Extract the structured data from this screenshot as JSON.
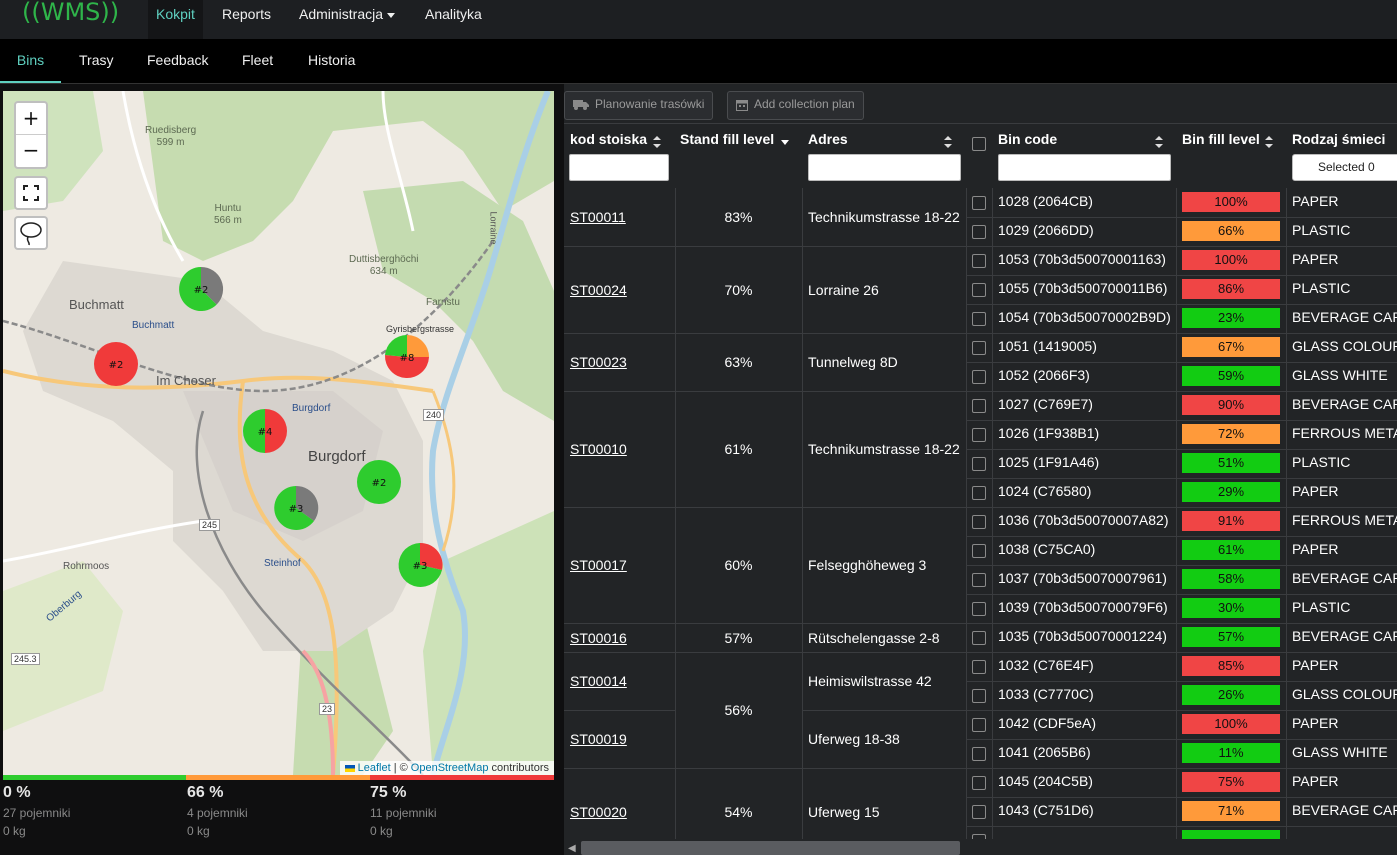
{
  "nav": {
    "logo": "((WMS))",
    "items": [
      {
        "label": "Kokpit",
        "active": true
      },
      {
        "label": "Reports",
        "active": false
      },
      {
        "label": "Administracja",
        "active": false,
        "dropdown": true
      },
      {
        "label": "Analityka",
        "active": false
      }
    ]
  },
  "tabs": [
    {
      "label": "Bins",
      "active": true
    },
    {
      "label": "Trasy",
      "active": false
    },
    {
      "label": "Feedback",
      "active": false
    },
    {
      "label": "Fleet",
      "active": false
    },
    {
      "label": "Historia",
      "active": false
    }
  ],
  "map": {
    "zoom_in": "+",
    "zoom_out": "−",
    "places": {
      "buchmatt": "Buchmatt",
      "buchmatt2": "Buchmatt",
      "im_choser": "Im Choser",
      "burgdorf": "Burgdorf",
      "burgdorf2": "Burgdorf",
      "steinhof": "Steinhof",
      "farnstu": "Farnstu",
      "duttisberg": "Duttisberghöchi",
      "duttisberg_h": "634 m",
      "huntu": "Huntu",
      "huntu_h": "566 m",
      "ruedisberg": "Ruedisberg",
      "ruedisberg_h": "599 m",
      "rohrmoos": "Rohrmoos",
      "oberburg": "Oberburg",
      "gyrisberg": "Gyrisbergstrasse",
      "lorraine": "Lorraine",
      "r240": "240",
      "r245": "245",
      "r2453": "245.3",
      "r23": "23"
    },
    "clusters": [
      {
        "label": "#2",
        "slices": [
          "#2ecc2e",
          "#7a7a7a"
        ]
      },
      {
        "label": "#2",
        "slices": [
          "#f03a3a"
        ]
      },
      {
        "label": "#8",
        "slices": [
          "#f03a3a",
          "#2ecc2e",
          "#ff9a3a"
        ]
      },
      {
        "label": "#4",
        "slices": [
          "#f03a3a",
          "#2ecc2e"
        ]
      },
      {
        "label": "#2",
        "slices": [
          "#2ecc2e"
        ]
      },
      {
        "label": "#3",
        "slices": [
          "#2ecc2e",
          "#7a7a7a"
        ]
      },
      {
        "label": "#3",
        "slices": [
          "#f03a3a",
          "#2ecc2e"
        ]
      }
    ],
    "attribution_prefix": "| ©",
    "attribution_leaflet": "Leaflet",
    "attribution_osm": "OpenStreetMap",
    "attribution_suffix": "contributors"
  },
  "stats": [
    {
      "pct": "0 %",
      "count": "27 pojemniki",
      "weight": "0 kg",
      "color": "#2ecc2e"
    },
    {
      "pct": "66 %",
      "count": "4 pojemniki",
      "weight": "0 kg",
      "color": "#ff9a3a"
    },
    {
      "pct": "75 %",
      "count": "11 pojemniki",
      "weight": "0 kg",
      "color": "#f03a3a"
    }
  ],
  "toolbar": {
    "plan_routes": "Planowanie trasówki",
    "add_plan": "Add collection plan"
  },
  "table": {
    "headers": {
      "code": "kod stoiska",
      "stand_fill": "Stand fill level",
      "address": "Adres",
      "bin_code": "Bin code",
      "bin_fill": "Bin fill level",
      "type": "Rodzaj śmieci"
    },
    "type_filter": "Selected 0",
    "stands": [
      {
        "code": "ST00011",
        "fill": "83%",
        "address": "Technikumstrasse 18-22"
      },
      {
        "code": "ST00024",
        "fill": "70%",
        "address": "Lorraine 26"
      },
      {
        "code": "ST00023",
        "fill": "63%",
        "address": "Tunnelweg 8D"
      },
      {
        "code": "ST00010",
        "fill": "61%",
        "address": "Technikumstrasse 18-22"
      },
      {
        "code": "ST00017",
        "fill": "60%",
        "address": "Felsegghöheweg 3"
      },
      {
        "code": "ST00016",
        "fill": "57%",
        "address": "Rütschelengasse 2-8"
      },
      {
        "code": "ST00014",
        "fill": "56%",
        "address": "Heimiswilstrasse 42"
      },
      {
        "code": "ST00019",
        "fill": "",
        "address": "Uferweg 18-38"
      },
      {
        "code": "ST00020",
        "fill": "54%",
        "address": "Uferweg 15"
      }
    ],
    "bins": [
      {
        "code": "1028 (2064CB)",
        "fill": "100%",
        "fill_value": 100,
        "color": "#f04545",
        "type": "PAPER"
      },
      {
        "code": "1029 (2066DD)",
        "fill": "66%",
        "fill_value": 66,
        "color": "#ff9a3a",
        "type": "PLASTIC"
      },
      {
        "code": "1053 (70b3d50070001163)",
        "fill": "100%",
        "fill_value": 100,
        "color": "#f04545",
        "type": "PAPER"
      },
      {
        "code": "1055 (70b3d500700011B6)",
        "fill": "86%",
        "fill_value": 86,
        "color": "#f04545",
        "type": "PLASTIC"
      },
      {
        "code": "1054 (70b3d50070002B9D)",
        "fill": "23%",
        "fill_value": 23,
        "color": "#12cc12",
        "type": "BEVERAGE CART"
      },
      {
        "code": "1051 (1419005)",
        "fill": "67%",
        "fill_value": 67,
        "color": "#ff9a3a",
        "type": "GLASS COLOURE"
      },
      {
        "code": "1052 (2066F3)",
        "fill": "59%",
        "fill_value": 59,
        "color": "#12cc12",
        "type": "GLASS WHITE"
      },
      {
        "code": "1027 (C769E7)",
        "fill": "90%",
        "fill_value": 90,
        "color": "#f04545",
        "type": "BEVERAGE CART"
      },
      {
        "code": "1026 (1F938B1)",
        "fill": "72%",
        "fill_value": 72,
        "color": "#ff9a3a",
        "type": "FERROUS METAL"
      },
      {
        "code": "1025 (1F91A46)",
        "fill": "51%",
        "fill_value": 51,
        "color": "#12cc12",
        "type": "PLASTIC"
      },
      {
        "code": "1024 (C76580)",
        "fill": "29%",
        "fill_value": 29,
        "color": "#12cc12",
        "type": "PAPER"
      },
      {
        "code": "1036 (70b3d50070007A82)",
        "fill": "91%",
        "fill_value": 91,
        "color": "#f04545",
        "type": "FERROUS METAL"
      },
      {
        "code": "1038 (C75CA0)",
        "fill": "61%",
        "fill_value": 61,
        "color": "#12cc12",
        "type": "PAPER"
      },
      {
        "code": "1037 (70b3d50070007961)",
        "fill": "58%",
        "fill_value": 58,
        "color": "#12cc12",
        "type": "BEVERAGE CART"
      },
      {
        "code": "1039 (70b3d500700079F6)",
        "fill": "30%",
        "fill_value": 30,
        "color": "#12cc12",
        "type": "PLASTIC"
      },
      {
        "code": "1035 (70b3d50070001224)",
        "fill": "57%",
        "fill_value": 57,
        "color": "#12cc12",
        "type": "BEVERAGE CART"
      },
      {
        "code": "1032 (C76E4F)",
        "fill": "85%",
        "fill_value": 85,
        "color": "#f04545",
        "type": "PAPER"
      },
      {
        "code": "1033 (C7770C)",
        "fill": "26%",
        "fill_value": 26,
        "color": "#12cc12",
        "type": "GLASS COLOURE"
      },
      {
        "code": "1042 (CDF5eA)",
        "fill": "100%",
        "fill_value": 100,
        "color": "#f04545",
        "type": "PAPER"
      },
      {
        "code": "1041 (2065B6)",
        "fill": "11%",
        "fill_value": 11,
        "color": "#12cc12",
        "type": "GLASS WHITE"
      },
      {
        "code": "1045 (204C5B)",
        "fill": "75%",
        "fill_value": 75,
        "color": "#f04545",
        "type": "PAPER"
      },
      {
        "code": "1043 (C751D6)",
        "fill": "71%",
        "fill_value": 71,
        "color": "#ff9a3a",
        "type": "BEVERAGE CART"
      }
    ]
  }
}
